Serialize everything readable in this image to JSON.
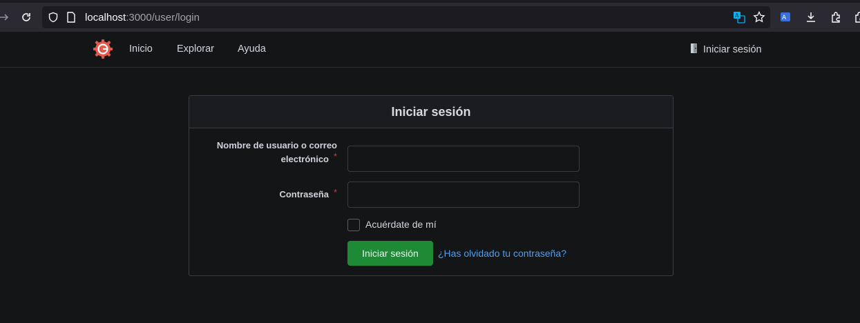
{
  "browser": {
    "url_host": "localhost",
    "url_path": ":3000/user/login"
  },
  "header": {
    "nav": [
      "Inicio",
      "Explorar",
      "Ayuda"
    ],
    "signin": "Iniciar sesión"
  },
  "login": {
    "title": "Iniciar sesión",
    "username_label_line1": "Nombre de usuario o correo",
    "username_label_line2": "electrónico",
    "password_label": "Contraseña",
    "required_mark": "*",
    "username_value": "",
    "password_value": "",
    "remember_label": "Acuérdate de mí",
    "submit_label": "Iniciar sesión",
    "forgot_label": "¿Has olvidado tu contraseña?"
  },
  "colors": {
    "accent_green": "#1e8a36",
    "link_blue": "#4f9ff0",
    "logo_red": "#e05a4e"
  }
}
